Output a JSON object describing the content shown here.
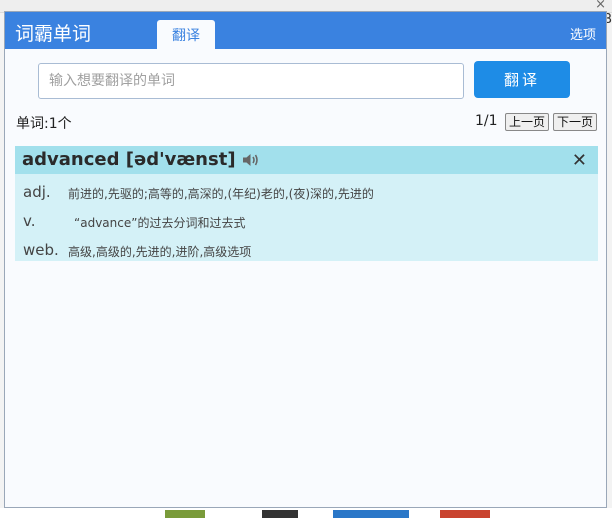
{
  "background": {
    "side_char": "B"
  },
  "popup": {
    "app_title": "词霸单词",
    "tab_label": "翻译",
    "options_label": "选项"
  },
  "search": {
    "placeholder": "输入想要翻译的单词",
    "value": "",
    "button_label": "翻译"
  },
  "results": {
    "count_label": "单词:1个",
    "page_indicator": "1/1",
    "prev_label": "上一页",
    "next_label": "下一页"
  },
  "entry": {
    "headword": "advanced [əd'vænst]",
    "definitions": [
      {
        "pos": "adj.",
        "meaning": "前进的,先驱的;高等的,高深的,(年纪)老的,(夜)深的,先进的"
      },
      {
        "pos": "v.",
        "meaning": "“advance”的过去分词和过去式"
      },
      {
        "pos": "web.",
        "meaning": "高级,高级的,先进的,进阶,高级选项"
      }
    ]
  },
  "colors": {
    "header": "#3a82e0",
    "button": "#1e8ce6",
    "card_head": "#a2e0ec",
    "card_body": "#d4f1f7"
  }
}
